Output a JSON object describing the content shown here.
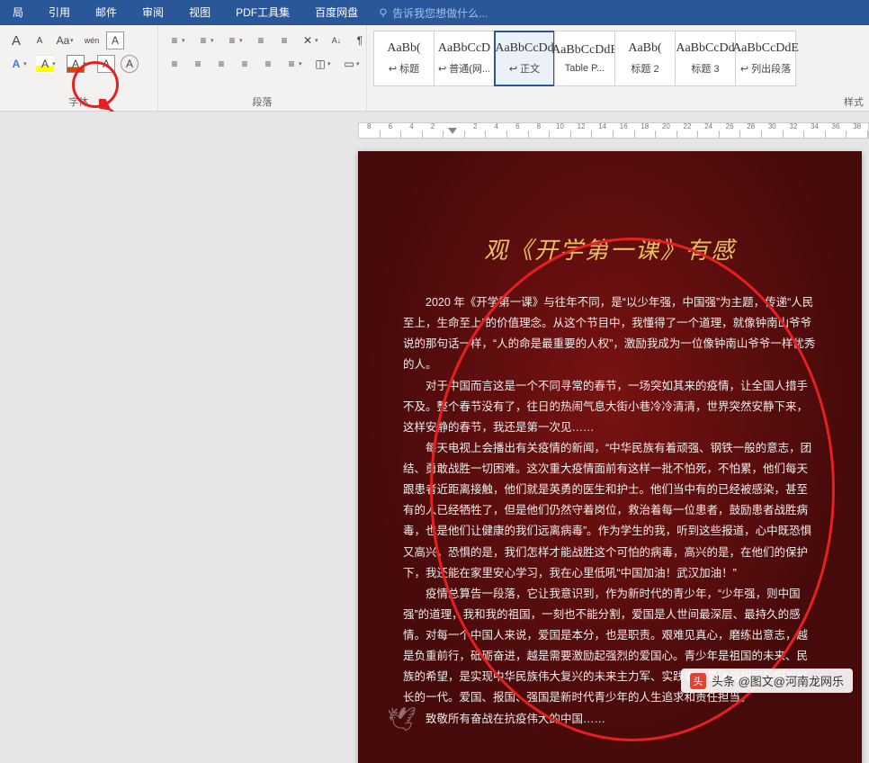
{
  "tabs": [
    "局",
    "引用",
    "邮件",
    "审阅",
    "视图",
    "PDF工具集",
    "百度网盘"
  ],
  "tellme": "告诉我您想做什么...",
  "group_font_label": "字体",
  "group_para_label": "段落",
  "group_styles_label": "样式",
  "font_row1": {
    "aplus": "A",
    "aminus": "A",
    "aa": "Aa",
    "wen": "wén",
    "box_a": "A"
  },
  "font_row2": {
    "a1": "A",
    "a2": "A",
    "a3": "A",
    "a4": "A",
    "a5": "A",
    "eraser": "◌"
  },
  "para_row1": {
    "bullets": "≡",
    "numbers": "≡",
    "multilevel": "≡",
    "ind_l": "≡",
    "ind_r": "≡",
    "sort": "A↓",
    "showmarks": "¶"
  },
  "para_row2": {
    "al": "≡",
    "ac": "≡",
    "ar": "≡",
    "aj": "≡",
    "dist": "≡",
    "ls": "≡",
    "shade": "◫",
    "border": "▭"
  },
  "styles": [
    {
      "sample": "AaBb(",
      "name": "标题",
      "href": "↩"
    },
    {
      "sample": "AaBbCcD",
      "name": "普通(网...",
      "href": "↩"
    },
    {
      "sample": "AaBbCcDd",
      "name": "正文",
      "href": "↩",
      "selected": true
    },
    {
      "sample": "AaBbCcDdE",
      "name": "Table P...",
      "href": ""
    },
    {
      "sample": "AaBb(",
      "name": "标题 2",
      "href": ""
    },
    {
      "sample": "AaBbCcDd",
      "name": "标题 3",
      "href": ""
    },
    {
      "sample": "AaBbCcDdE",
      "name": "列出段落",
      "href": "↩"
    }
  ],
  "ruler": [
    "8",
    "6",
    "4",
    "2",
    "",
    "2",
    "4",
    "6",
    "8",
    "10",
    "12",
    "14",
    "16",
    "18",
    "20",
    "22",
    "24",
    "26",
    "28",
    "30",
    "32",
    "34",
    "36",
    "38"
  ],
  "document": {
    "title": "观《开学第一课》有感",
    "paragraphs": [
      "2020 年《开学第一课》与往年不同，是“以少年强，中国强”为主题，传递“人民至上，生命至上”的价值理念。从这个节目中，我懂得了一个道理，就像钟南山爷爷说的那句话一样，“人的命是最重要的人权”，激励我成为一位像钟南山爷爷一样优秀的人。",
      "对于中国而言这是一个不同寻常的春节，一场突如其来的疫情，让全国人措手不及。整个春节没有了，往日的热闹气息大街小巷冷冷清清，世界突然安静下来，这样安静的春节，我还是第一次见……",
      "每天电视上会播出有关疫情的新闻，“中华民族有着顽强、钢铁一般的意志，团结、勇敢战胜一切困难。这次重大疫情面前有这样一批不怕死，不怕累，他们每天跟患者近距离接触，他们就是英勇的医生和护士。他们当中有的已经被感染，甚至有的人已经牺牲了，但是他们仍然守着岗位，救治着每一位患者，鼓励患者战胜病毒，也是他们让健康的我们远离病毒”。作为学生的我，听到这些报道，心中既恐惧又高兴，恐惧的是，我们怎样才能战胜这个可怕的病毒，高兴的是，在他们的保护下，我还能在家里安心学习，我在心里低吼“中国加油！武汉加油！”",
      "疫情总算告一段落，它让我意识到，作为新时代的青少年，“少年强，则中国强”的道理，我和我的祖国，一刻也不能分割，爱国是人世间最深层、最持久的感情。对每一个中国人来说，爱国是本分，也是职责。艰难见真心，磨练出意志，越是负重前行，砥砺奋进，越是需要激励起强烈的爱国心。青少年是祖国的未来、民族的希望，是实现中华民族伟大复兴的未来主力军、实践者，是沐浴祖国的阳光成长的一代。爱国、报国、强国是新时代青少年的人生追求和责任担当。",
      "致敬所有奋战在抗疫伟大的中国……"
    ]
  },
  "watermark": "头条 @图文@河南龙网乐"
}
